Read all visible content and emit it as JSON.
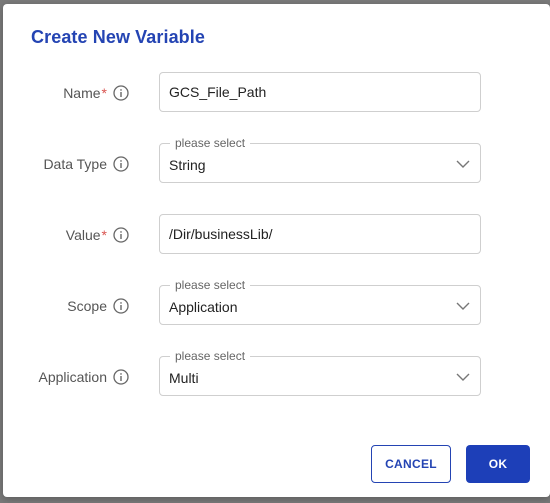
{
  "dialog": {
    "title": "Create New Variable"
  },
  "form": {
    "name": {
      "label": "Name",
      "required_mark": "*",
      "value": "GCS_File_Path"
    },
    "data_type": {
      "label": "Data Type",
      "legend": "please select",
      "value": "String"
    },
    "value": {
      "label": "Value",
      "required_mark": "*",
      "value": "/Dir/businessLib/"
    },
    "scope": {
      "label": "Scope",
      "legend": "please select",
      "value": "Application"
    },
    "application": {
      "label": "Application",
      "legend": "please select",
      "value": "Multi"
    }
  },
  "actions": {
    "cancel_label": "CANCEL",
    "ok_label": "OK"
  },
  "colors": {
    "title": "#2444b3",
    "required": "#d9534f",
    "primary": "#1d3fb8"
  }
}
